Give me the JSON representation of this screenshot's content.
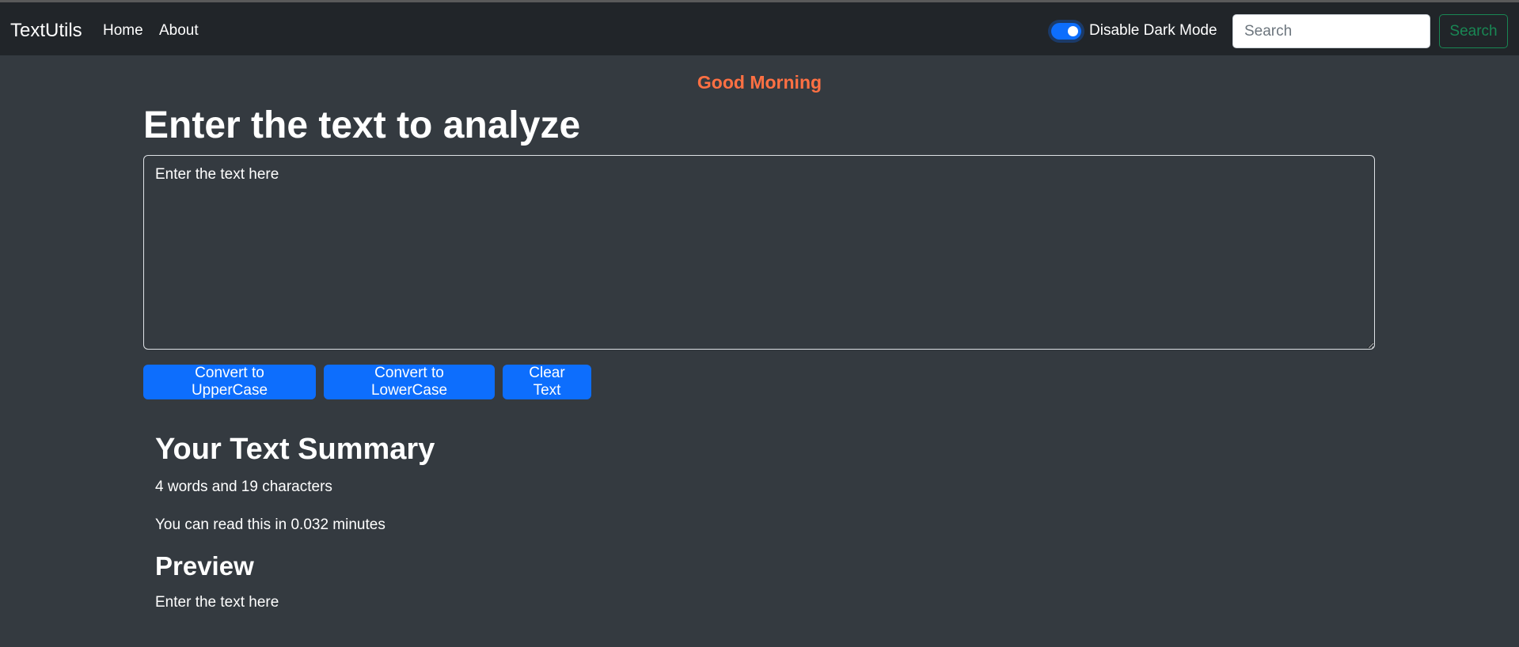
{
  "navbar": {
    "brand": "TextUtils",
    "links": [
      {
        "label": "Home"
      },
      {
        "label": "About"
      }
    ],
    "dark_mode_toggle": {
      "label": "Disable Dark Mode",
      "checked": true
    },
    "search": {
      "placeholder": "Search",
      "value": "",
      "button_label": "Search"
    }
  },
  "greeting": "Good Morning",
  "main": {
    "heading": "Enter the text to analyze",
    "textarea_value": "Enter the text here",
    "buttons": [
      {
        "label": "Convert to UpperCase"
      },
      {
        "label": "Convert to LowerCase"
      },
      {
        "label": "Clear Text"
      }
    ]
  },
  "summary": {
    "heading": "Your Text Summary",
    "counts": "4 words and 19 characters",
    "read_time": "You can read this in 0.032 minutes",
    "preview_heading": "Preview",
    "preview_text": "Enter the text here"
  },
  "colors": {
    "accent": "#0d6efd",
    "greeting": "#ff7043",
    "search_outline": "#198754",
    "navbar_bg": "#212529",
    "page_bg": "#343a40"
  }
}
